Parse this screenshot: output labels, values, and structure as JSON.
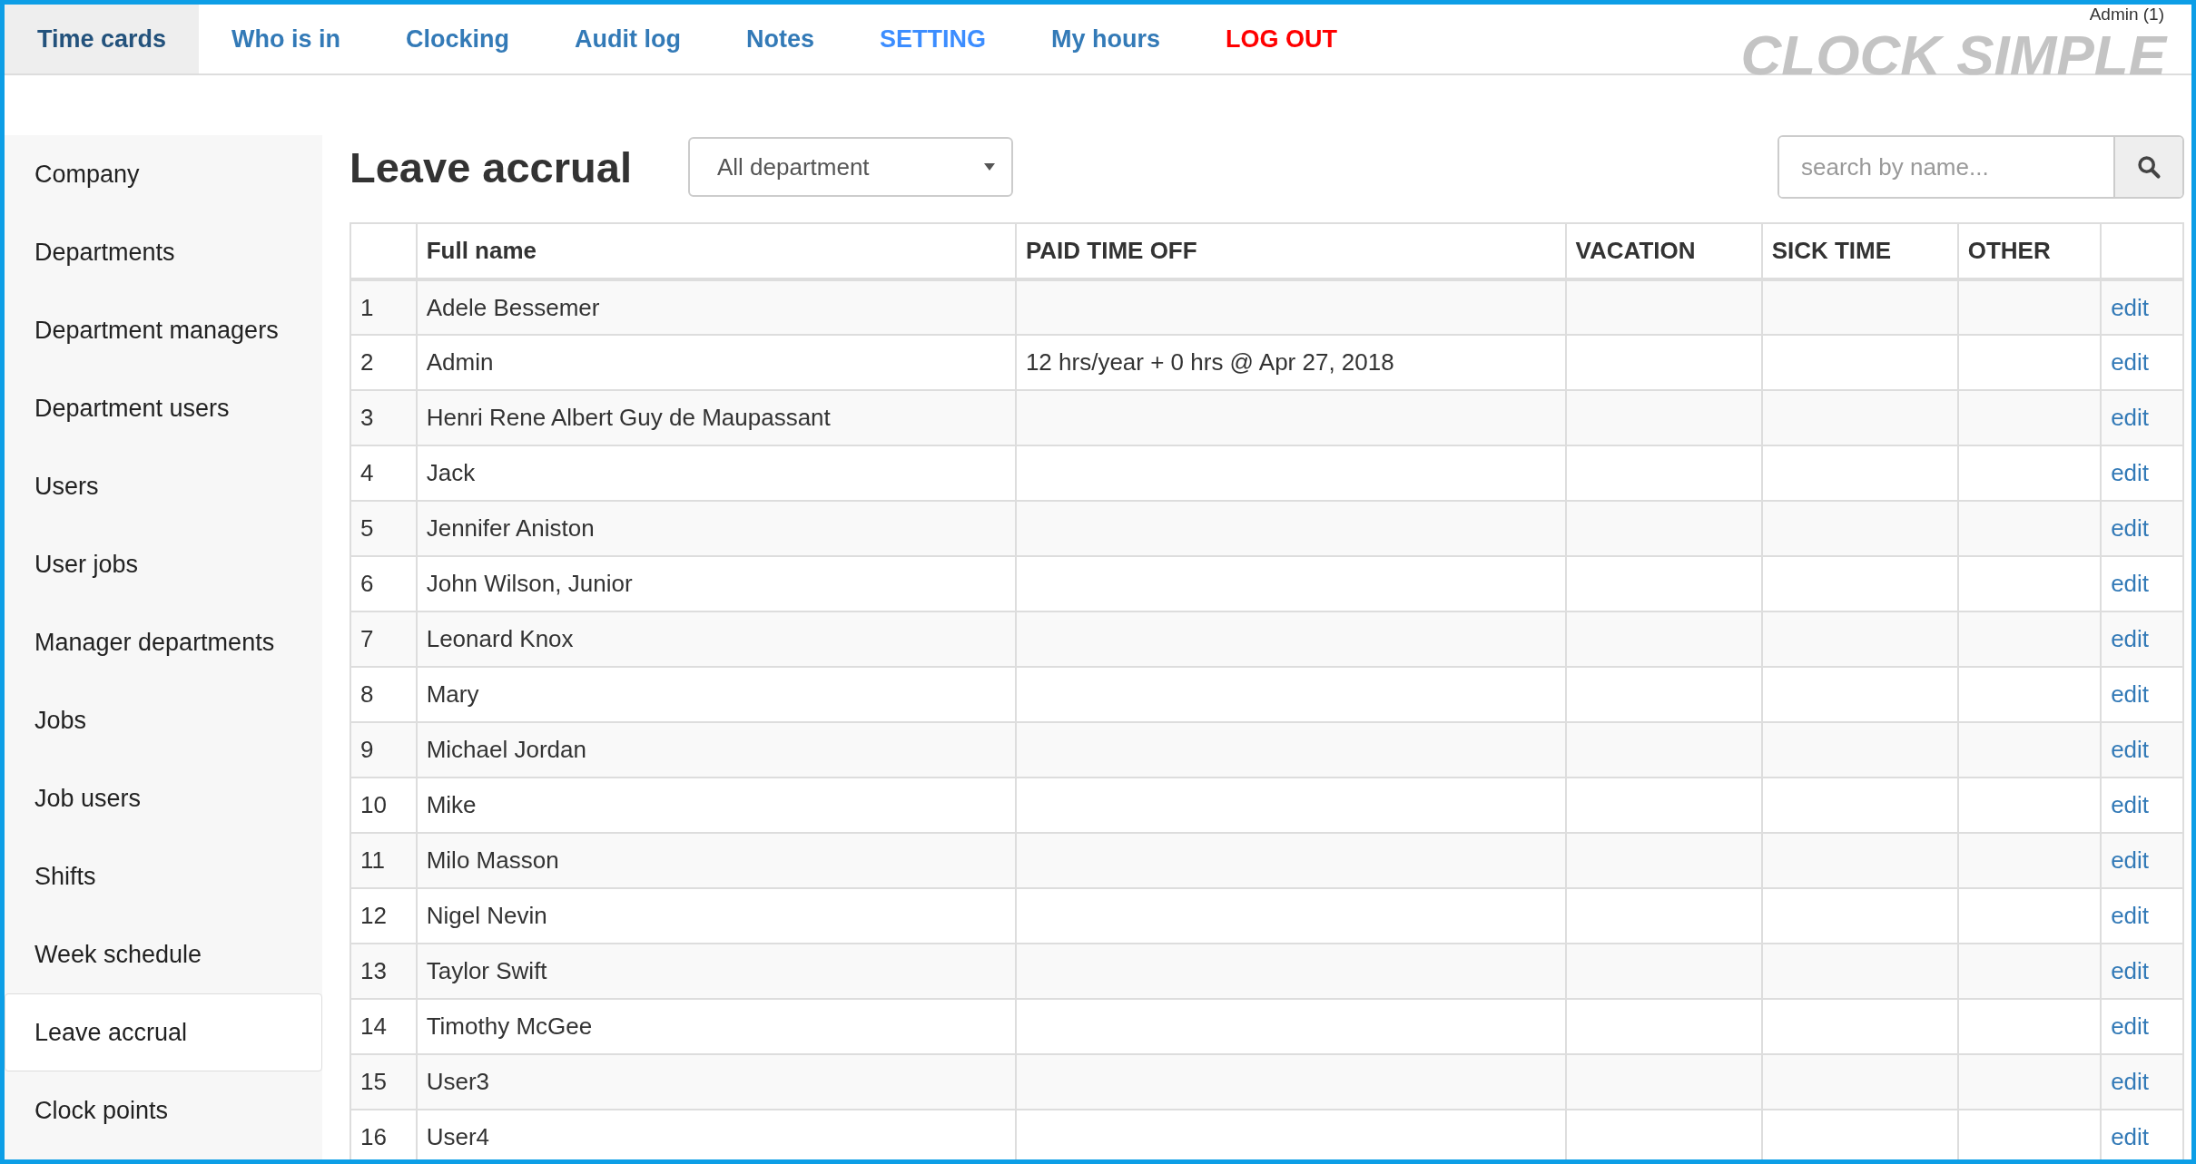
{
  "nav": {
    "tabs": [
      {
        "label": "Time cards",
        "selected": true,
        "kind": "normal"
      },
      {
        "label": "Who is in",
        "selected": false,
        "kind": "normal"
      },
      {
        "label": "Clocking",
        "selected": false,
        "kind": "normal"
      },
      {
        "label": "Audit log",
        "selected": false,
        "kind": "normal"
      },
      {
        "label": "Notes",
        "selected": false,
        "kind": "normal"
      },
      {
        "label": "SETTING",
        "selected": false,
        "kind": "highlight"
      },
      {
        "label": "My hours",
        "selected": false,
        "kind": "normal"
      },
      {
        "label": "LOG OUT",
        "selected": false,
        "kind": "danger"
      }
    ],
    "user": "Admin (1)",
    "logo": "CLOCK SIMPLE"
  },
  "sidebar": {
    "items": [
      {
        "label": "Company",
        "selected": false
      },
      {
        "label": "Departments",
        "selected": false
      },
      {
        "label": "Department managers",
        "selected": false
      },
      {
        "label": "Department users",
        "selected": false
      },
      {
        "label": "Users",
        "selected": false
      },
      {
        "label": "User jobs",
        "selected": false
      },
      {
        "label": "Manager departments",
        "selected": false
      },
      {
        "label": "Jobs",
        "selected": false
      },
      {
        "label": "Job users",
        "selected": false
      },
      {
        "label": "Shifts",
        "selected": false
      },
      {
        "label": "Week schedule",
        "selected": false
      },
      {
        "label": "Leave accrual",
        "selected": true
      },
      {
        "label": "Clock points",
        "selected": false
      }
    ]
  },
  "page": {
    "title": "Leave accrual",
    "department_select": {
      "value": "All department"
    },
    "search": {
      "placeholder": "search by name..."
    }
  },
  "table": {
    "columns": [
      "",
      "Full name",
      "PAID TIME OFF",
      "VACATION",
      "SICK TIME",
      "OTHER",
      ""
    ],
    "rows": [
      [
        "1",
        "Adele Bessemer",
        "",
        "",
        "",
        "",
        "edit"
      ],
      [
        "2",
        "Admin",
        "12 hrs/year + 0 hrs @ Apr 27, 2018",
        "",
        "",
        "",
        "edit"
      ],
      [
        "3",
        "Henri Rene Albert Guy de Maupassant",
        "",
        "",
        "",
        "",
        "edit"
      ],
      [
        "4",
        "Jack",
        "",
        "",
        "",
        "",
        "edit"
      ],
      [
        "5",
        "Jennifer Aniston",
        "",
        "",
        "",
        "",
        "edit"
      ],
      [
        "6",
        "John Wilson, Junior",
        "",
        "",
        "",
        "",
        "edit"
      ],
      [
        "7",
        "Leonard Knox",
        "",
        "",
        "",
        "",
        "edit"
      ],
      [
        "8",
        "Mary",
        "",
        "",
        "",
        "",
        "edit"
      ],
      [
        "9",
        "Michael Jordan",
        "",
        "",
        "",
        "",
        "edit"
      ],
      [
        "10",
        "Mike",
        "",
        "",
        "",
        "",
        "edit"
      ],
      [
        "11",
        "Milo Masson",
        "",
        "",
        "",
        "",
        "edit"
      ],
      [
        "12",
        "Nigel Nevin",
        "",
        "",
        "",
        "",
        "edit"
      ],
      [
        "13",
        "Taylor Swift",
        "",
        "",
        "",
        "",
        "edit"
      ],
      [
        "14",
        "Timothy McGee",
        "",
        "",
        "",
        "",
        "edit"
      ],
      [
        "15",
        "User3",
        "",
        "",
        "",
        "",
        "edit"
      ],
      [
        "16",
        "User4",
        "",
        "",
        "",
        "",
        "edit"
      ]
    ]
  }
}
